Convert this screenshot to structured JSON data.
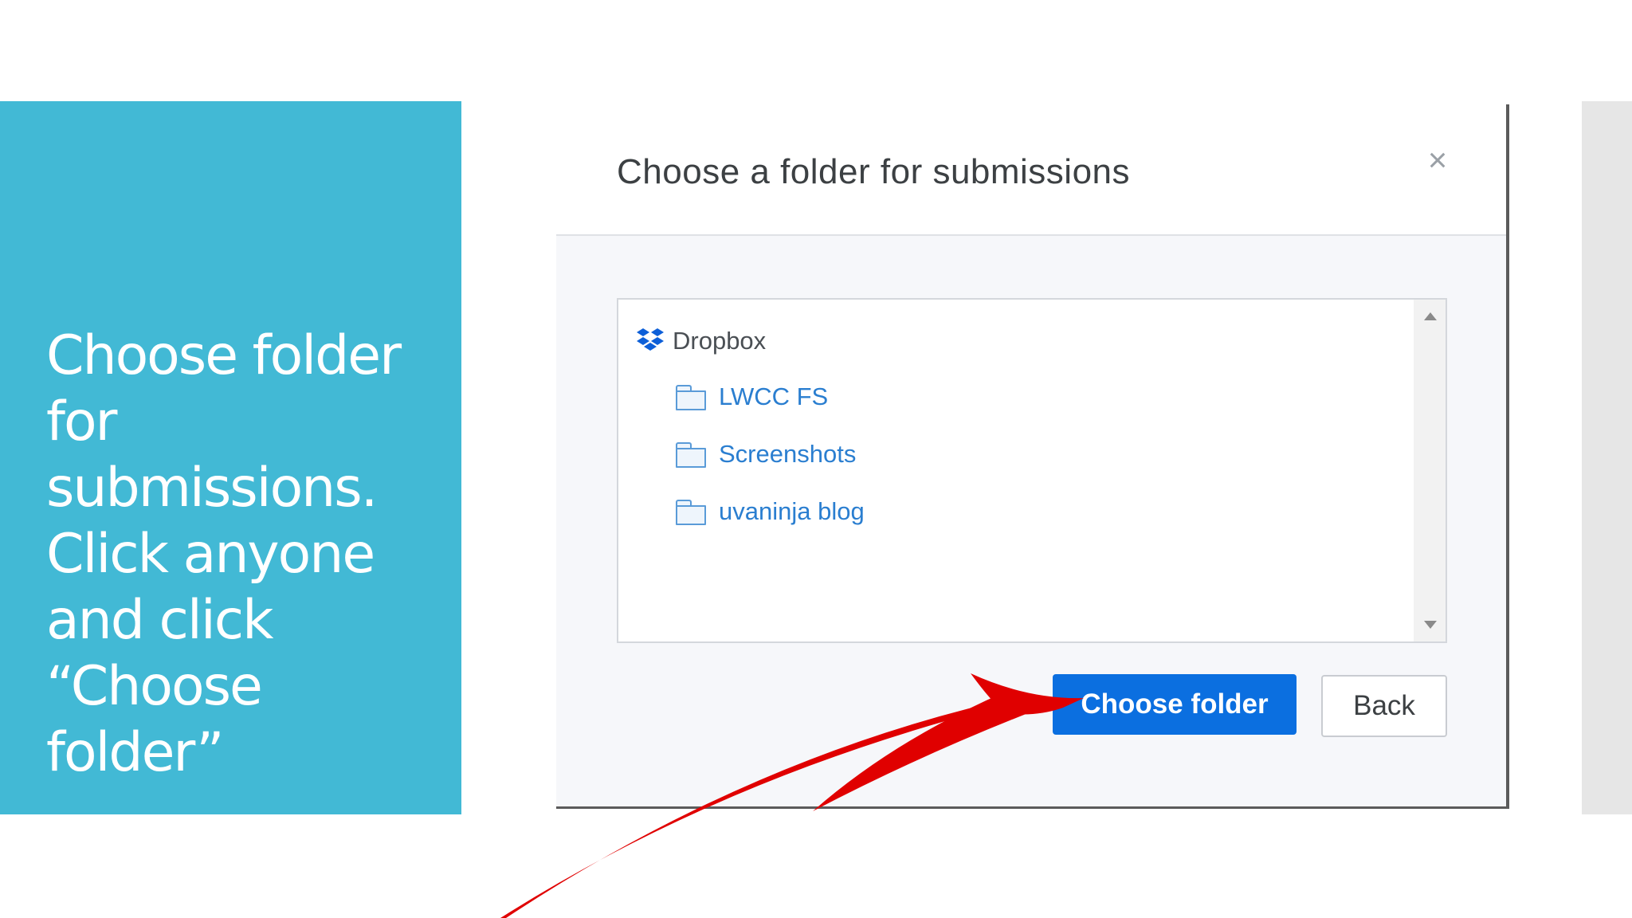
{
  "slide": {
    "instruction_text": "Choose folder\nfor\nsubmissions.\nClick anyone\nand click\n“Choose\nfolder”"
  },
  "dialog": {
    "title": "Choose a folder for submissions",
    "close_symbol": "×",
    "tree": {
      "root": {
        "label": "Dropbox",
        "icon": "dropbox-icon"
      },
      "folders": [
        {
          "label": "LWCC FS",
          "icon": "folder-icon"
        },
        {
          "label": "Screenshots",
          "icon": "folder-icon"
        },
        {
          "label": "uvaninja blog",
          "icon": "folder-icon"
        }
      ]
    },
    "buttons": {
      "primary_label": "Choose folder",
      "secondary_label": "Back"
    }
  },
  "colors": {
    "panel_background": "#42b9d5",
    "primary_button": "#0b6fe0",
    "folder_link": "#2a7ed0",
    "annotation_arrow": "#e00000"
  }
}
